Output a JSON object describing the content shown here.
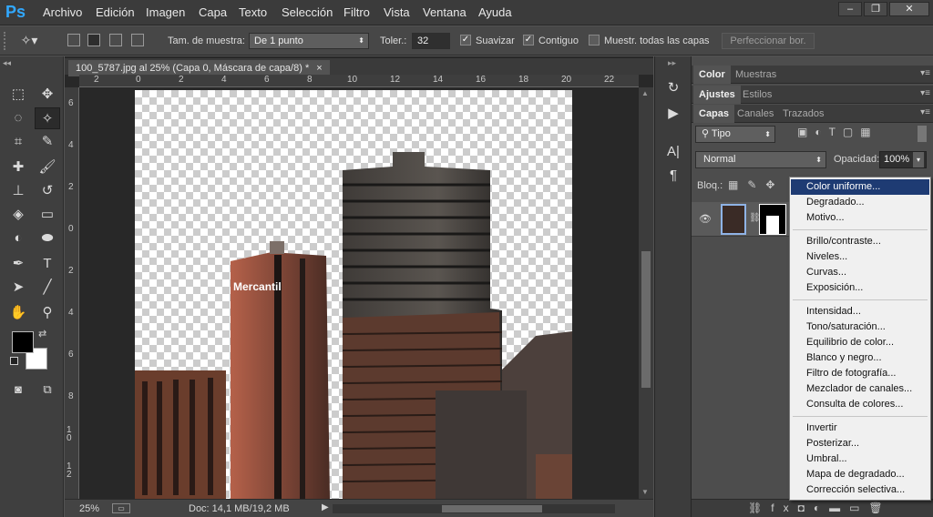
{
  "app": {
    "logo": "Ps"
  },
  "menubar": {
    "items": [
      "Archivo",
      "Edición",
      "Imagen",
      "Capa",
      "Texto",
      "Selección",
      "Filtro",
      "Vista",
      "Ventana",
      "Ayuda"
    ],
    "window_controls": [
      "–",
      "❐",
      "✕"
    ]
  },
  "options": {
    "sample_size_label": "Tam. de muestra:",
    "sample_size_value": "De 1 punto",
    "tolerance_label": "Toler.:",
    "tolerance_value": "32",
    "antialias_label": "Suavizar",
    "antialias_checked": true,
    "contiguous_label": "Contiguo",
    "contiguous_checked": true,
    "sample_all_label": "Muestr. todas las capas",
    "sample_all_checked": false,
    "refine_label": "Perfeccionar bor."
  },
  "document": {
    "tab_title": "100_5787.jpg al 25% (Capa 0, Máscara de capa/8) *",
    "close": "×",
    "ruler_h": [
      "2",
      "0",
      "2",
      "4",
      "6",
      "8",
      "10",
      "12",
      "14",
      "16",
      "18",
      "20",
      "22"
    ],
    "ruler_v": [
      "6",
      "4",
      "2",
      "0",
      "2",
      "4",
      "6",
      "8",
      "1 0",
      "1 2"
    ],
    "sign_text": "Mercantil"
  },
  "status": {
    "zoom": "25%",
    "doc": "Doc: 14,1 MB/19,2 MB"
  },
  "panels": {
    "row1": [
      "Color",
      "Muestras"
    ],
    "row2": [
      "Ajustes",
      "Estilos"
    ],
    "row3": [
      "Capas",
      "Canales",
      "Trazados"
    ],
    "filter_kind": "Tipo",
    "blend_mode": "Normal",
    "opacity_label": "Opacidad:",
    "opacity_value": "100%",
    "lock_label": "Bloq.:"
  },
  "adjust_menu": {
    "groups": [
      [
        "Color uniforme...",
        "Degradado...",
        "Motivo..."
      ],
      [
        "Brillo/contraste...",
        "Niveles...",
        "Curvas...",
        "Exposición..."
      ],
      [
        "Intensidad...",
        "Tono/saturación...",
        "Equilibrio de color...",
        "Blanco y negro...",
        "Filtro de fotografía...",
        "Mezclador de canales...",
        "Consulta de colores..."
      ],
      [
        "Invertir",
        "Posterizar...",
        "Umbral...",
        "Mapa de degradado...",
        "Corrección selectiva..."
      ]
    ],
    "highlighted": "Color uniforme..."
  },
  "colors": {
    "accent": "#1e3b73",
    "ps_blue": "#31a8ff",
    "foreground": "#000000",
    "background": "#ffffff"
  }
}
